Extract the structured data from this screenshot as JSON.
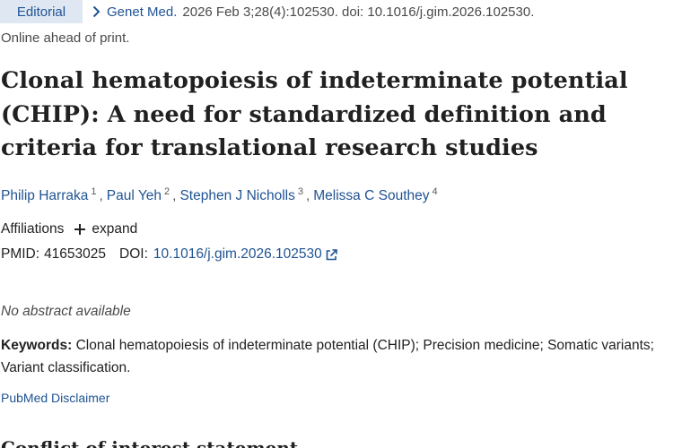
{
  "header": {
    "badge": "Editorial",
    "journal": "Genet Med.",
    "citation": "2026 Feb 3;28(4):102530. doi: 10.1016/j.gim.2026.102530.",
    "status": "Online ahead of print."
  },
  "article": {
    "title": "Clonal hematopoiesis of indeterminate potential (CHIP): A need for standardized definition and criteria for translational research studies"
  },
  "authors": [
    {
      "name": "Philip Harraka",
      "sup": "1"
    },
    {
      "name": "Paul Yeh",
      "sup": "2"
    },
    {
      "name": "Stephen J Nicholls",
      "sup": "3"
    },
    {
      "name": "Melissa C Southey",
      "sup": "4"
    }
  ],
  "affiliations": {
    "label": "Affiliations",
    "expand_label": "expand"
  },
  "identifiers": {
    "pmid_label": "PMID:",
    "pmid": "41653025",
    "doi_label": "DOI:",
    "doi": "10.1016/j.gim.2026.102530"
  },
  "abstract_note": "No abstract available",
  "keywords": {
    "label": "Keywords:",
    "text": "Clonal hematopoiesis of indeterminate potential (CHIP); Precision medicine; Somatic variants; Variant classification."
  },
  "disclaimer_link": "PubMed Disclaimer",
  "next_section_heading": "Conflict of interest statement",
  "colors": {
    "link": "#205493",
    "badge_bg": "#dfe7f2",
    "text": "#212121"
  },
  "icons": [
    "chevron-right-icon",
    "plus-icon",
    "external-link-icon"
  ]
}
